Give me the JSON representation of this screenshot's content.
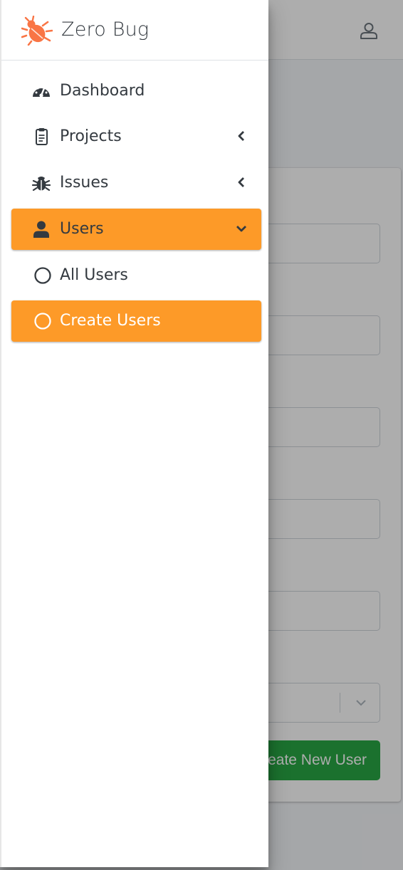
{
  "brand": {
    "name": "Zero Bug",
    "logo_icon": "bug-logo-icon",
    "accent": "#f97545"
  },
  "header": {
    "user_icon": "user-icon"
  },
  "sidebar": {
    "items": [
      {
        "label": "Dashboard",
        "icon": "tachometer-icon",
        "active": false
      },
      {
        "label": "Projects",
        "icon": "clipboard-icon",
        "chevron": "chevron-left-icon",
        "active": false
      },
      {
        "label": "Issues",
        "icon": "bug-icon",
        "chevron": "chevron-left-icon",
        "active": false
      },
      {
        "label": "Users",
        "icon": "user-icon",
        "chevron": "chevron-down-icon",
        "active": true
      },
      {
        "label": "All Users",
        "icon": "circle-icon",
        "active": false
      },
      {
        "label": "Create Users",
        "icon": "circle-icon",
        "active": true
      }
    ],
    "active_color": "#fd9a28"
  },
  "form": {
    "submit_label": "Create New User",
    "submit_color": "#28a745"
  }
}
